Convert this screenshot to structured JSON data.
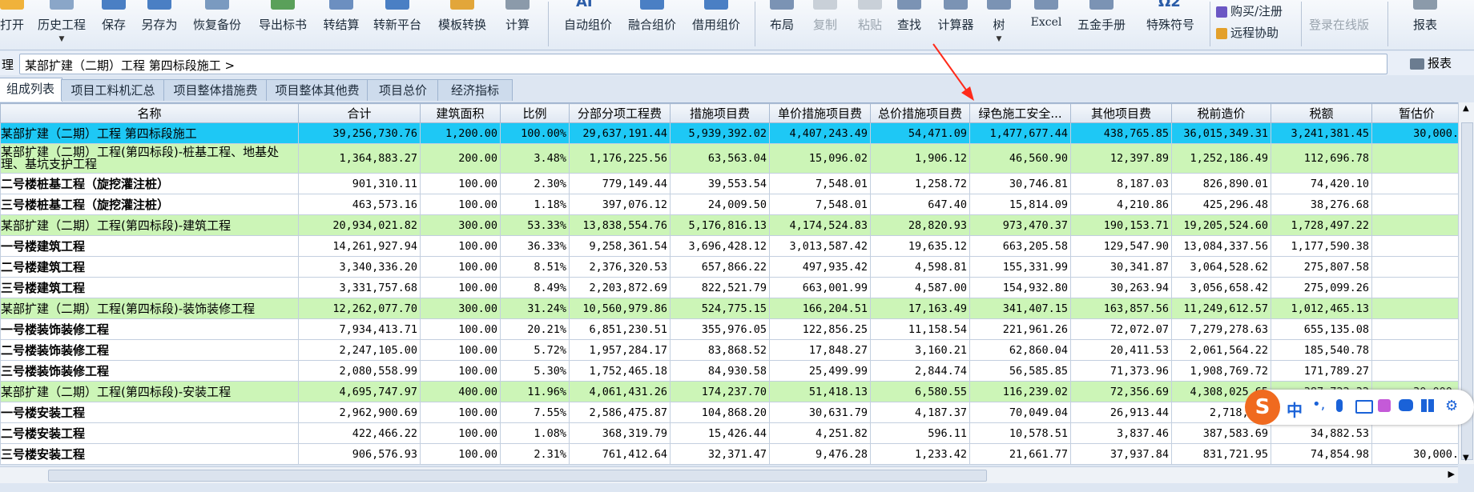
{
  "toolbar": {
    "left_buttons": [
      {
        "label": "打开"
      },
      {
        "label": "历史工程"
      },
      {
        "label": "保存"
      },
      {
        "label": "另存为"
      },
      {
        "label": "恢复备份"
      },
      {
        "label": "导出标书"
      },
      {
        "label": "转结算"
      },
      {
        "label": "转新平台"
      },
      {
        "label": "模板转换"
      },
      {
        "label": "计算"
      }
    ],
    "mid_buttons": [
      {
        "label": "自动组价"
      },
      {
        "label": "融合组价"
      },
      {
        "label": "借用组价"
      }
    ],
    "tool_buttons": [
      {
        "label": "布局"
      },
      {
        "label": "复制"
      },
      {
        "label": "粘贴"
      },
      {
        "label": "查找"
      },
      {
        "label": "计算器"
      },
      {
        "label": "树"
      },
      {
        "label": "Excel"
      },
      {
        "label": "五金手册"
      },
      {
        "label": "特殊符号"
      }
    ],
    "buy_register": "购买/注册",
    "remote_help": "远程协助",
    "login_online": "登录在线版",
    "report": "报表",
    "ai_label": "AI",
    "omega_label": "Ω2"
  },
  "breadcrumb": {
    "left_fragment": "理",
    "path": "某部扩建（二期）工程 第四标段施工 >",
    "report_button": "报表"
  },
  "tabs": [
    {
      "label": "组成列表",
      "active": true
    },
    {
      "label": "项目工料机汇总"
    },
    {
      "label": "项目整体措施费"
    },
    {
      "label": "项目整体其他费"
    },
    {
      "label": "项目总价"
    },
    {
      "label": "经济指标"
    }
  ],
  "table": {
    "columns": [
      "名称",
      "合计",
      "建筑面积",
      "比例",
      "分部分项工程费",
      "措施项目费",
      "单价措施项目费",
      "总价措施项目费",
      "绿色施工安全...",
      "其他项目费",
      "税前造价",
      "税额",
      "暂估价"
    ],
    "rows": [
      {
        "type": "sel",
        "cells": [
          "某部扩建（二期）工程 第四标段施工",
          "39,256,730.76",
          "1,200.00",
          "100.00%",
          "29,637,191.44",
          "5,939,392.02",
          "4,407,243.49",
          "54,471.09",
          "1,477,677.44",
          "438,765.85",
          "36,015,349.31",
          "3,241,381.45",
          "30,000."
        ]
      },
      {
        "type": "green tall",
        "cells": [
          "某部扩建（二期）工程(第四标段)-桩基工程、地基处理、基坑支护工程",
          "1,364,883.27",
          "200.00",
          "3.48%",
          "1,176,225.56",
          "63,563.04",
          "15,096.02",
          "1,906.12",
          "46,560.90",
          "12,397.89",
          "1,252,186.49",
          "112,696.78",
          ""
        ]
      },
      {
        "type": "",
        "cells": [
          "二号楼桩基工程（旋挖灌注桩）",
          "901,310.11",
          "100.00",
          "2.30%",
          "779,149.44",
          "39,553.54",
          "7,548.01",
          "1,258.72",
          "30,746.81",
          "8,187.03",
          "826,890.01",
          "74,420.10",
          ""
        ]
      },
      {
        "type": "",
        "cells": [
          "三号楼桩基工程（旋挖灌注桩）",
          "463,573.16",
          "100.00",
          "1.18%",
          "397,076.12",
          "24,009.50",
          "7,548.01",
          "647.40",
          "15,814.09",
          "4,210.86",
          "425,296.48",
          "38,276.68",
          ""
        ]
      },
      {
        "type": "green",
        "cells": [
          "某部扩建（二期）工程(第四标段)-建筑工程",
          "20,934,021.82",
          "300.00",
          "53.33%",
          "13,838,554.76",
          "5,176,816.13",
          "4,174,524.83",
          "28,820.93",
          "973,470.37",
          "190,153.71",
          "19,205,524.60",
          "1,728,497.22",
          ""
        ]
      },
      {
        "type": "",
        "cells": [
          "一号楼建筑工程",
          "14,261,927.94",
          "100.00",
          "36.33%",
          "9,258,361.54",
          "3,696,428.12",
          "3,013,587.42",
          "19,635.12",
          "663,205.58",
          "129,547.90",
          "13,084,337.56",
          "1,177,590.38",
          ""
        ]
      },
      {
        "type": "",
        "cells": [
          "二号楼建筑工程",
          "3,340,336.20",
          "100.00",
          "8.51%",
          "2,376,320.53",
          "657,866.22",
          "497,935.42",
          "4,598.81",
          "155,331.99",
          "30,341.87",
          "3,064,528.62",
          "275,807.58",
          ""
        ]
      },
      {
        "type": "",
        "cells": [
          "三号楼建筑工程",
          "3,331,757.68",
          "100.00",
          "8.49%",
          "2,203,872.69",
          "822,521.79",
          "663,001.99",
          "4,587.00",
          "154,932.80",
          "30,263.94",
          "3,056,658.42",
          "275,099.26",
          ""
        ]
      },
      {
        "type": "green",
        "cells": [
          "某部扩建（二期）工程(第四标段)-装饰装修工程",
          "12,262,077.70",
          "300.00",
          "31.24%",
          "10,560,979.86",
          "524,775.15",
          "166,204.51",
          "17,163.49",
          "341,407.15",
          "163,857.56",
          "11,249,612.57",
          "1,012,465.13",
          ""
        ]
      },
      {
        "type": "",
        "cells": [
          "一号楼装饰装修工程",
          "7,934,413.71",
          "100.00",
          "20.21%",
          "6,851,230.51",
          "355,976.05",
          "122,856.25",
          "11,158.54",
          "221,961.26",
          "72,072.07",
          "7,279,278.63",
          "655,135.08",
          ""
        ]
      },
      {
        "type": "",
        "cells": [
          "二号楼装饰装修工程",
          "2,247,105.00",
          "100.00",
          "5.72%",
          "1,957,284.17",
          "83,868.52",
          "17,848.27",
          "3,160.21",
          "62,860.04",
          "20,411.53",
          "2,061,564.22",
          "185,540.78",
          ""
        ]
      },
      {
        "type": "",
        "cells": [
          "三号楼装饰装修工程",
          "2,080,558.99",
          "100.00",
          "5.30%",
          "1,752,465.18",
          "84,930.58",
          "25,499.99",
          "2,844.74",
          "56,585.85",
          "71,373.96",
          "1,908,769.72",
          "171,789.27",
          ""
        ]
      },
      {
        "type": "green",
        "cells": [
          "某部扩建（二期）工程(第四标段)-安装工程",
          "4,695,747.97",
          "400.00",
          "11.96%",
          "4,061,431.26",
          "174,237.70",
          "51,418.13",
          "6,580.55",
          "116,239.02",
          "72,356.69",
          "4,308,025.65",
          "387,722.32",
          "30,000."
        ]
      },
      {
        "type": "",
        "cells": [
          "一号楼安装工程",
          "2,962,900.69",
          "100.00",
          "7.55%",
          "2,586,475.87",
          "104,868.20",
          "30,631.79",
          "4,187.37",
          "70,049.04",
          "26,913.44",
          "2,718,257",
          "",
          ""
        ]
      },
      {
        "type": "",
        "cells": [
          "二号楼安装工程",
          "422,466.22",
          "100.00",
          "1.08%",
          "368,319.79",
          "15,426.44",
          "4,251.82",
          "596.11",
          "10,578.51",
          "3,837.46",
          "387,583.69",
          "34,882.53",
          ""
        ]
      },
      {
        "type": "",
        "cells": [
          "三号楼安装工程",
          "906,576.93",
          "100.00",
          "2.31%",
          "761,412.64",
          "32,371.47",
          "9,476.28",
          "1,233.42",
          "21,661.77",
          "37,937.84",
          "831,721.95",
          "74,854.98",
          "30,000."
        ]
      }
    ]
  },
  "ime": {
    "brand": "S",
    "mode": "中",
    "punct": "•,"
  },
  "colors": {
    "selected_row": "#1ec8f5",
    "group_row": "#ccf5b7",
    "annotation_arrow": "#ff2a1a"
  }
}
